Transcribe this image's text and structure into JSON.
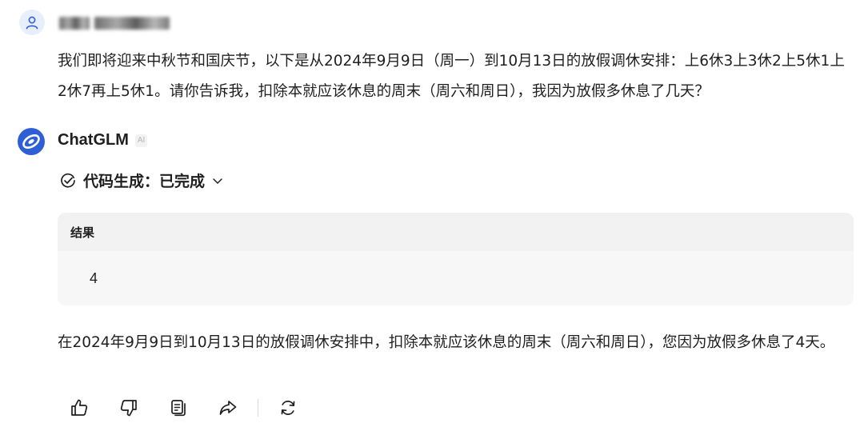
{
  "user": {
    "avatar_icon": "user-icon",
    "message": "我们即将迎来中秋节和国庆节，以下是从2024年9月9日（周一）到10月13日的放假调休安排：上6休3上3休2上5休1上2休7再上5休1。请你告诉我，扣除本就应该休息的周末（周六和周日），我因为放假多休息了几天？"
  },
  "assistant": {
    "name": "ChatGLM",
    "badge": "AI",
    "avatar_icon": "chatglm-logo-icon",
    "tool_status": "代码生成：已完成",
    "result_header": "结果",
    "result_value": "4",
    "answer": "在2024年9月9日到10月13日的放假调休安排中，扣除本就应该休息的周末（周六和周日），您因为放假多休息了4天。"
  },
  "toolbar": {
    "icons": [
      "thumbs-up-icon",
      "thumbs-down-icon",
      "copy-icon",
      "share-icon",
      "regenerate-icon"
    ]
  },
  "colors": {
    "brand_blue": "#2f5fd6",
    "text": "#1f1f1f",
    "result_bg": "#f7f7f8"
  }
}
